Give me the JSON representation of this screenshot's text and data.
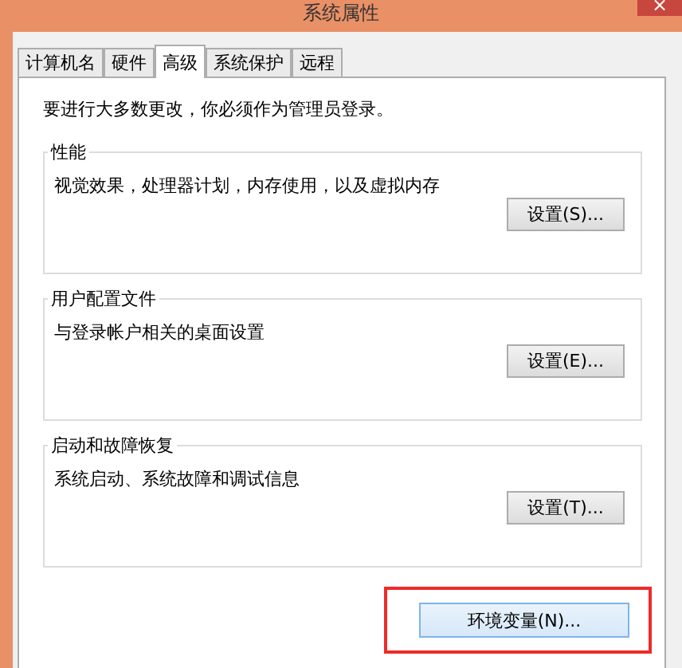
{
  "window": {
    "title": "系统属性",
    "close": "×"
  },
  "tabs": [
    {
      "label": "计算机名",
      "selected": false
    },
    {
      "label": "硬件",
      "selected": false
    },
    {
      "label": "高级",
      "selected": true
    },
    {
      "label": "系统保护",
      "selected": false
    },
    {
      "label": "远程",
      "selected": false
    }
  ],
  "notice": "要进行大多数更改，你必须作为管理员登录。",
  "groups": [
    {
      "title": "性能",
      "description": "视觉效果，处理器计划，内存使用，以及虚拟内存",
      "button": "设置(S)..."
    },
    {
      "title": "用户配置文件",
      "description": "与登录帐户相关的桌面设置",
      "button": "设置(E)..."
    },
    {
      "title": "启动和故障恢复",
      "description": "系统启动、系统故障和调试信息",
      "button": "设置(T)..."
    }
  ],
  "env_button": {
    "label": "环境变量(N)...",
    "highlighted": true
  }
}
